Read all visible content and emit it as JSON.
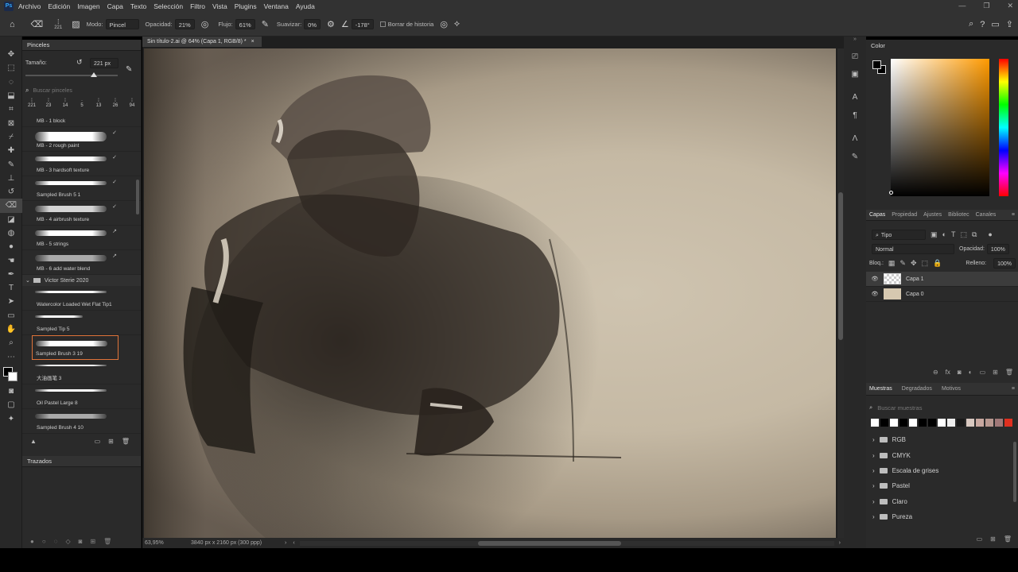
{
  "menu": {
    "ps_label": "Ps",
    "items": [
      "Archivo",
      "Edición",
      "Imagen",
      "Capa",
      "Texto",
      "Selección",
      "Filtro",
      "Vista",
      "Plugins",
      "Ventana",
      "Ayuda"
    ]
  },
  "options": {
    "size_value": "221",
    "mode_label": "Modo:",
    "mode_value": "Pincel",
    "opacity_label": "Opacidad:",
    "opacity_value": "21%",
    "flow_label": "Flujo:",
    "flow_value": "61%",
    "smooth_label": "Suavizar:",
    "smooth_value": "0%",
    "angle_value": "-178°",
    "history_label": "Borrar de historia"
  },
  "brushes": {
    "panel_title": "Pinceles",
    "size_label": "Tamaño:",
    "size_value": "221 px",
    "search_placeholder": "Buscar pinceles",
    "presets": [
      "221",
      "23",
      "14",
      "5",
      "13",
      "26",
      "94"
    ],
    "items": [
      {
        "label": "MB - 1 block"
      },
      {
        "label": "MB - 2 rough paint"
      },
      {
        "label": "MB - 3 hardsoft texture"
      },
      {
        "label": "Sampled Brush 5 1"
      },
      {
        "label": "MB - 4 airbrush texture"
      },
      {
        "label": "MB - 5 strings"
      },
      {
        "label": "MB - 6 add water blend"
      }
    ],
    "group_label": "Victor Sterie 2020",
    "group_items": [
      {
        "label": "Watercolor Loaded Wet Flat Tip1"
      },
      {
        "label": "Sampled Tip 5"
      },
      {
        "label": "Sampled Brush 3 19"
      },
      {
        "label": "大油画笔 3"
      },
      {
        "label": "Oil Pastel Large 8"
      },
      {
        "label": "Sampled Brush 4 10"
      }
    ],
    "paths_title": "Trazados"
  },
  "document": {
    "tab_title": "Sin título-2.ai @ 64% (Capa 1, RGB/8) *",
    "zoom": "63,95%",
    "doc_info": "3840 px x 2160 px (300 ppp)"
  },
  "color": {
    "title": "Color"
  },
  "layers": {
    "tabs": [
      "Capas",
      "Propiedad",
      "Ajustes",
      "Bibliotec",
      "Canales"
    ],
    "filter_label": "Tipo",
    "blend_mode": "Normal",
    "opacity_label": "Opacidad:",
    "opacity_value": "100%",
    "lock_label": "Bloq.:",
    "fill_label": "Relleno:",
    "fill_value": "100%",
    "list": [
      {
        "name": "Capa 1"
      },
      {
        "name": "Capa 0"
      }
    ]
  },
  "swatches": {
    "tabs": [
      "Muestras",
      "Degradados",
      "Motivos"
    ],
    "search_placeholder": "Buscar muestras",
    "colors": [
      "#ffffff",
      "#000000",
      "#ffffff",
      "#000000",
      "#ffffff",
      "#000000",
      "#000000",
      "#ffffff",
      "#eeeeee",
      "#1a1a1a",
      "#d8c8c0",
      "#c8a8a0",
      "#b89890",
      "#a07878",
      "#e03020"
    ],
    "folders": [
      "RGB",
      "CMYK",
      "Escala de grises",
      "Pastel",
      "Claro",
      "Pureza"
    ]
  }
}
